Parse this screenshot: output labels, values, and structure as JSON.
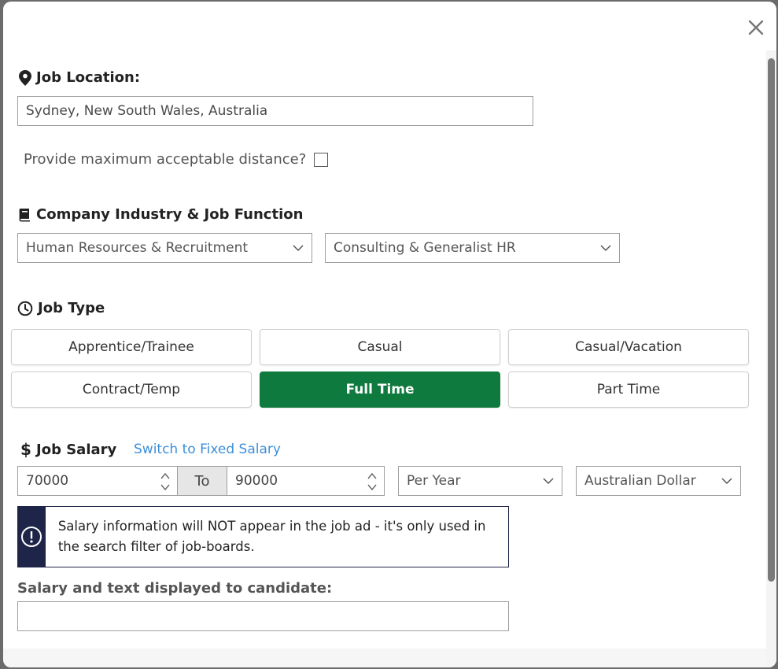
{
  "location": {
    "title": "Job Location:",
    "value": "Sydney, New South Wales, Australia",
    "distance_label": "Provide maximum acceptable distance?"
  },
  "industry": {
    "title": "Company Industry & Job Function",
    "industry_value": "Human Resources & Recruitment",
    "function_value": "Consulting & Generalist HR"
  },
  "job_type": {
    "title": "Job Type",
    "options": [
      "Apprentice/Trainee",
      "Casual",
      "Casual/Vacation",
      "Contract/Temp",
      "Full Time",
      "Part Time"
    ],
    "selected": "Full Time",
    "accent_color": "#0f7a3d"
  },
  "salary": {
    "title": "Job Salary",
    "switch_link": "Switch to Fixed Salary",
    "min": "70000",
    "to_label": "To",
    "max": "90000",
    "period": "Per Year",
    "currency": "Australian Dollar",
    "notice": "Salary information will NOT appear in the job ad - it's only used in the search filter of job-boards.",
    "display_label": "Salary and text displayed to candidate:",
    "display_value": ""
  },
  "icons": {
    "close": "close-icon",
    "location": "map-marker-icon",
    "industry": "book-icon",
    "job_type": "clock-icon",
    "salary": "dollar-icon",
    "notice": "info-icon"
  }
}
